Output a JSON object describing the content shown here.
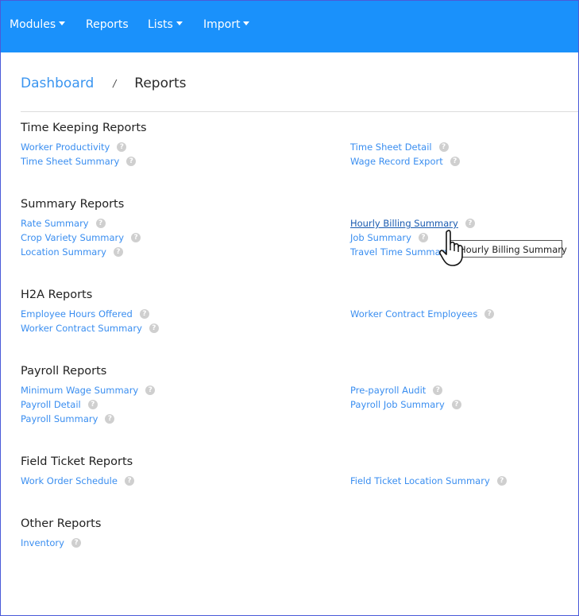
{
  "navbar": {
    "items": [
      {
        "label": "Modules",
        "has_dropdown": true
      },
      {
        "label": "Reports",
        "has_dropdown": false
      },
      {
        "label": "Lists",
        "has_dropdown": true
      },
      {
        "label": "Import",
        "has_dropdown": true
      }
    ],
    "background_color": "#1a91fb"
  },
  "breadcrumb": {
    "home": "Dashboard",
    "separator": "/",
    "current": "Reports"
  },
  "help_icon_glyph": "?",
  "sections": [
    {
      "title": "Time Keeping Reports",
      "left": [
        "Worker Productivity",
        "Time Sheet Summary"
      ],
      "right": [
        "Time Sheet Detail",
        "Wage Record Export"
      ]
    },
    {
      "title": "Summary Reports",
      "left": [
        "Rate Summary",
        "Crop Variety Summary",
        "Location Summary"
      ],
      "right": [
        "Hourly Billing Summary",
        "Job Summary",
        "Travel Time Summary"
      ]
    },
    {
      "title": "H2A Reports",
      "left": [
        "Employee Hours Offered",
        "Worker Contract Summary"
      ],
      "right": [
        "Worker Contract Employees"
      ]
    },
    {
      "title": "Payroll Reports",
      "left": [
        "Minimum Wage Summary",
        "Payroll Detail",
        "Payroll Summary"
      ],
      "right": [
        "Pre-payroll Audit",
        "Payroll Job Summary"
      ]
    },
    {
      "title": "Field Ticket Reports",
      "left": [
        "Work Order Schedule"
      ],
      "right": [
        "Field Ticket Location Summary"
      ]
    },
    {
      "title": "Other Reports",
      "left": [
        "Inventory"
      ],
      "right": []
    }
  ],
  "hovered_link": "Hourly Billing Summary",
  "tooltip": {
    "text": "Hourly Billing Summary"
  },
  "colors": {
    "link": "#3a8ef0",
    "link_hover": "#1a5bb0",
    "help_icon": "#cfcfcf"
  }
}
